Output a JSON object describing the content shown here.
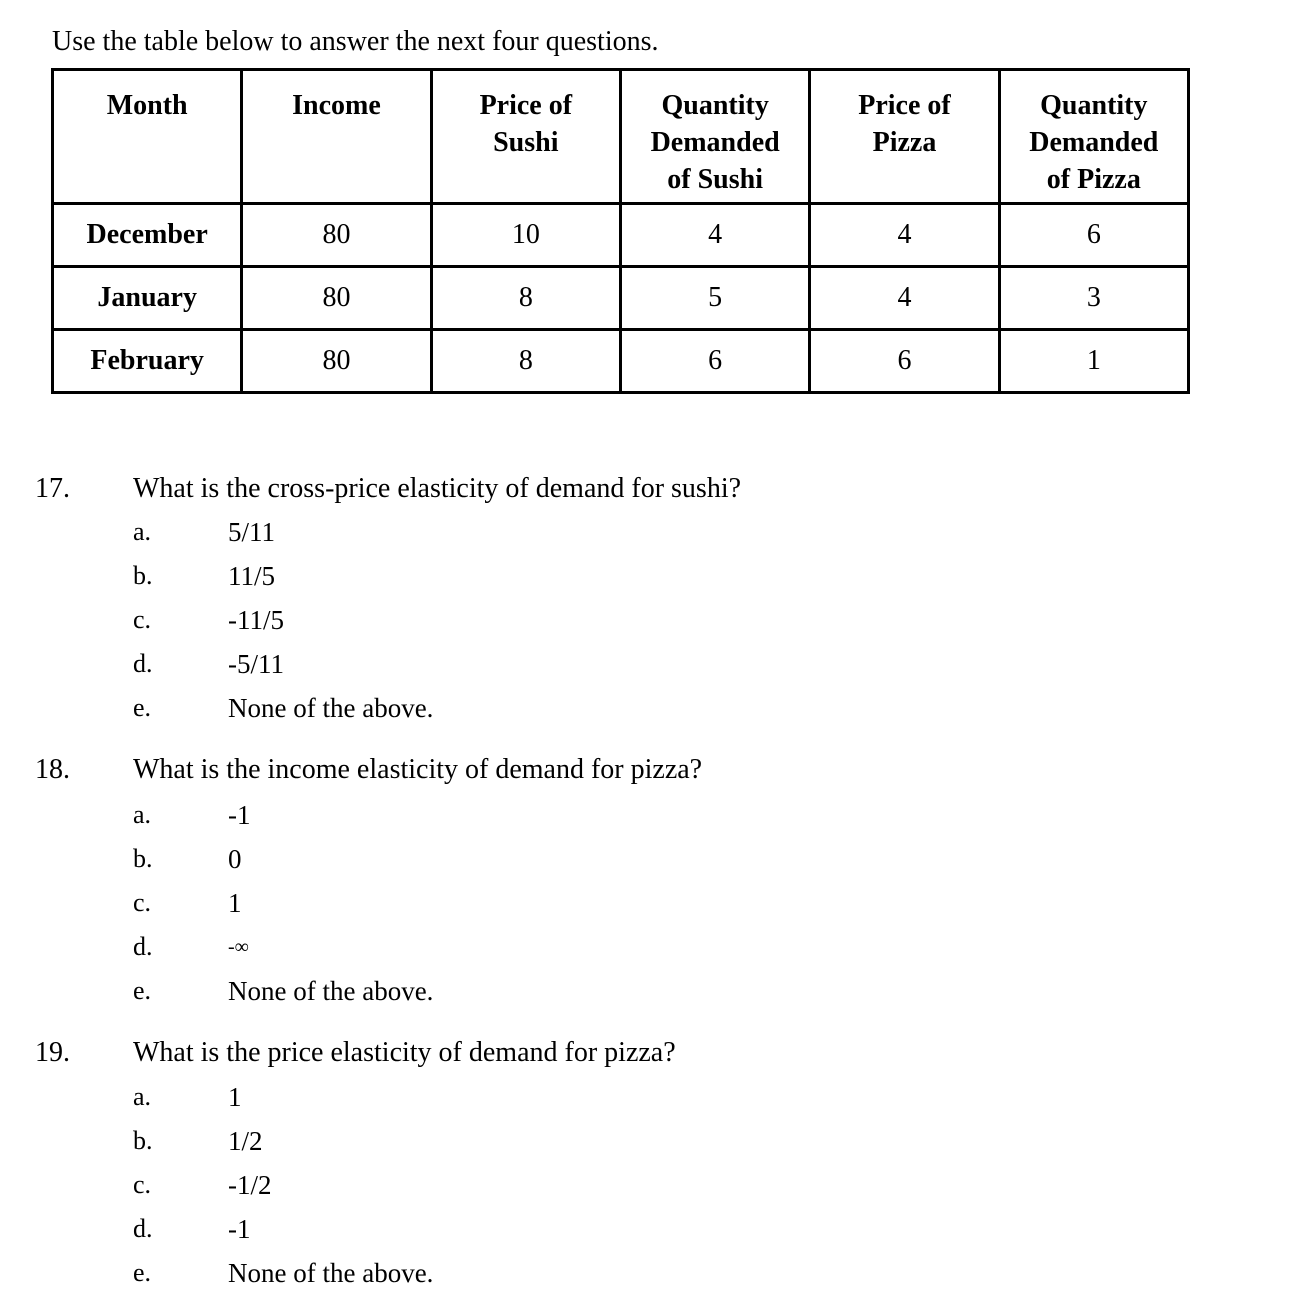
{
  "intro": "Use the table below to answer the next four questions.",
  "table": {
    "headers": [
      [
        "Month"
      ],
      [
        "Income"
      ],
      [
        "Price of",
        "Sushi"
      ],
      [
        "Quantity",
        "Demanded",
        "of Sushi"
      ],
      [
        "Price of",
        "Pizza"
      ],
      [
        "Quantity",
        "Demanded",
        "of Pizza"
      ]
    ],
    "rows": [
      {
        "month": "December",
        "income": "80",
        "price_sushi": "10",
        "qty_sushi": "4",
        "price_pizza": "4",
        "qty_pizza": "6"
      },
      {
        "month": "January",
        "income": "80",
        "price_sushi": "8",
        "qty_sushi": "5",
        "price_pizza": "4",
        "qty_pizza": "3"
      },
      {
        "month": "February",
        "income": "80",
        "price_sushi": "8",
        "qty_sushi": "6",
        "price_pizza": "6",
        "qty_pizza": "1"
      }
    ]
  },
  "questions": [
    {
      "number": "17.",
      "text": "What is the cross-price elasticity of demand for sushi?",
      "options": [
        {
          "letter": "a.",
          "value": "5/11"
        },
        {
          "letter": "b.",
          "value": "11/5"
        },
        {
          "letter": "c.",
          "value": "-11/5"
        },
        {
          "letter": "d.",
          "value": "-5/11"
        },
        {
          "letter": "e.",
          "value": "None of the above."
        }
      ]
    },
    {
      "number": "18.",
      "text": "What is the income elasticity of demand for pizza?",
      "options": [
        {
          "letter": "a.",
          "value": "-1"
        },
        {
          "letter": "b.",
          "value": "0"
        },
        {
          "letter": "c.",
          "value": "1"
        },
        {
          "letter": "d.",
          "value": "-∞"
        },
        {
          "letter": "e.",
          "value": "None of the above."
        }
      ]
    },
    {
      "number": "19.",
      "text": "What is the price elasticity of demand for pizza?",
      "options": [
        {
          "letter": "a.",
          "value": "1"
        },
        {
          "letter": "b.",
          "value": "1/2"
        },
        {
          "letter": "c.",
          "value": "-1/2"
        },
        {
          "letter": "d.",
          "value": "-1"
        },
        {
          "letter": "e.",
          "value": "None of the above."
        }
      ]
    }
  ]
}
